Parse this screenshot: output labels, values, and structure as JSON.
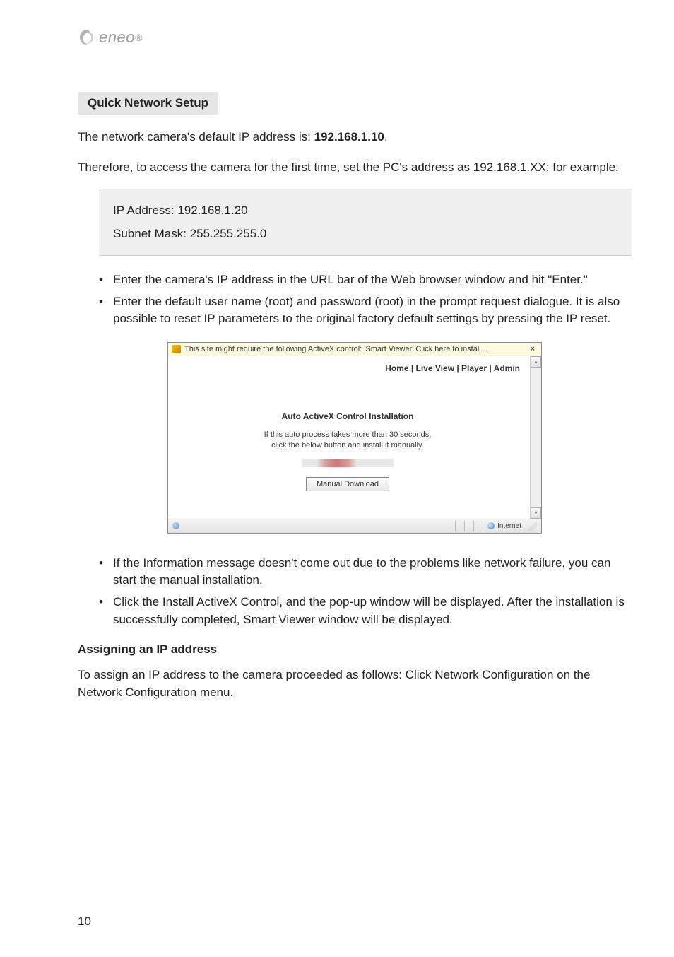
{
  "logo_text": "eneo",
  "heading_quick_network": "Quick Network Setup",
  "para_default_ip_pre": "The network camera's default IP address is: ",
  "para_default_ip_value": "192.168.1.10",
  "para_default_ip_post": ".",
  "para_access": "Therefore, to access the camera for the first time, set the PC's address as 192.168.1.XX; for example:",
  "infobox": {
    "line1": "IP Address: 192.168.1.20",
    "line2": "Subnet Mask: 255.255.255.0"
  },
  "bullets1": [
    "Enter the camera's IP address in the URL bar of the Web browser window and hit \"Enter.\"",
    "Enter the default user name (root) and password (root) in the prompt request dialogue. It is also possible to reset IP parameters to the original factory default settings by pressing the IP reset."
  ],
  "screenshot": {
    "info_bar": "This site might require the following ActiveX control: 'Smart Viewer' Click here to install...",
    "close_x": "×",
    "nav": "Home  |  Live View  |  Player  |  Admin",
    "title": "Auto ActiveX Control Installation",
    "msg_line1": "If this auto process takes more than 30 seconds,",
    "msg_line2": "click the below button and install it manually.",
    "btn": "Manual Download",
    "scroll_up": "▴",
    "scroll_down": "▾",
    "status_zone": "Internet"
  },
  "bullets2": [
    "If the Information message doesn't come out due to the problems like network failure, you can start the manual installation.",
    "Click the Install ActiveX Control, and the pop-up window will be displayed. After the installation is successfully completed, Smart Viewer window will be displayed."
  ],
  "subheading_assign": "Assigning an IP address",
  "para_assign": "To assign an IP address to the camera proceeded as follows: Click Network Configuration on the Network Configuration menu.",
  "page_number": "10"
}
